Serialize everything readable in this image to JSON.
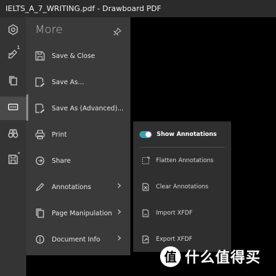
{
  "window": {
    "title": "IELTS_A_7_WRITING.pdf - Drawboard PDF"
  },
  "rail": {
    "items": [
      {
        "icon": "gear-icon"
      },
      {
        "icon": "annotation-stack-icon",
        "badge": "1"
      },
      {
        "icon": "copy-pages-icon"
      },
      {
        "icon": "more-dots-icon"
      },
      {
        "icon": "binoculars-icon"
      },
      {
        "icon": "save-icon",
        "badge": "*"
      }
    ]
  },
  "more_panel": {
    "title": "More",
    "items": [
      {
        "label": "Save & Close",
        "icon": "save-icon"
      },
      {
        "label": "Save As...",
        "icon": "save-as-icon"
      },
      {
        "label": "Save As (Advanced)...",
        "icon": "save-as-advanced-icon"
      },
      {
        "label": "Print",
        "icon": "print-icon"
      },
      {
        "label": "Share",
        "icon": "share-icon"
      },
      {
        "label": "Annotations",
        "icon": "pen-icon"
      },
      {
        "label": "Page Manipulation",
        "icon": "pages-icon"
      },
      {
        "label": "Document Info",
        "icon": "info-icon"
      }
    ]
  },
  "annotations_submenu": {
    "items": [
      {
        "label": "Show Annotations",
        "icon": "toggle-icon",
        "toggled": true
      },
      {
        "label": "Flatten Annotations",
        "icon": "flatten-icon"
      },
      {
        "label": "Clear Annotations",
        "icon": "clear-doc-icon"
      },
      {
        "label": "Import XFDF",
        "icon": "import-icon"
      },
      {
        "label": "Export XFDF",
        "icon": "export-icon"
      }
    ]
  },
  "watermark": {
    "badge": "值",
    "text": "什么值得买"
  },
  "colors": {
    "accent": "#3b9fb0",
    "panel_bg": "#3a3a3a",
    "rail_bg": "#343434",
    "titlebar_bg": "#2b2b2b"
  }
}
